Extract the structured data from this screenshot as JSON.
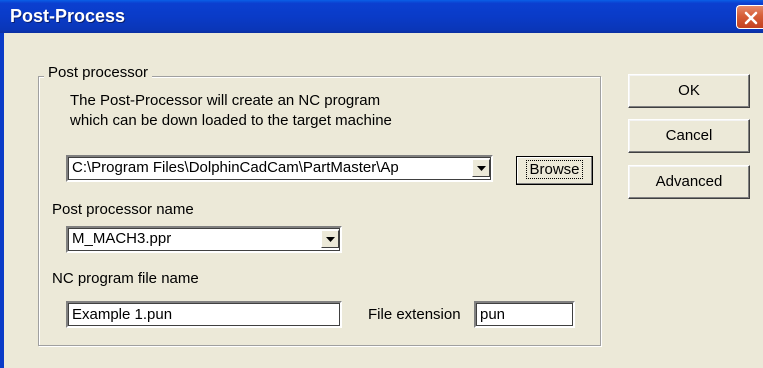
{
  "window": {
    "title": "Post-Process"
  },
  "group": {
    "legend": "Post processor",
    "description_line1": "The Post-Processor will create an NC program",
    "description_line2": "which can be down loaded to the target machine",
    "path_value": "C:\\Program Files\\DolphinCadCam\\PartMaster\\Ap",
    "browse_label": "Browse",
    "pp_name_label": "Post processor name",
    "pp_name_value": "M_MACH3.ppr",
    "nc_file_label": "NC program file name",
    "nc_file_value": "Example 1.pun",
    "ext_label": "File extension",
    "ext_value": "pun"
  },
  "buttons": {
    "ok": "OK",
    "cancel": "Cancel",
    "advanced": "Advanced"
  },
  "colors": {
    "title_bar": "#0a3bc8",
    "dialog_bg": "#ece9d8",
    "close_button": "#d65e37"
  }
}
